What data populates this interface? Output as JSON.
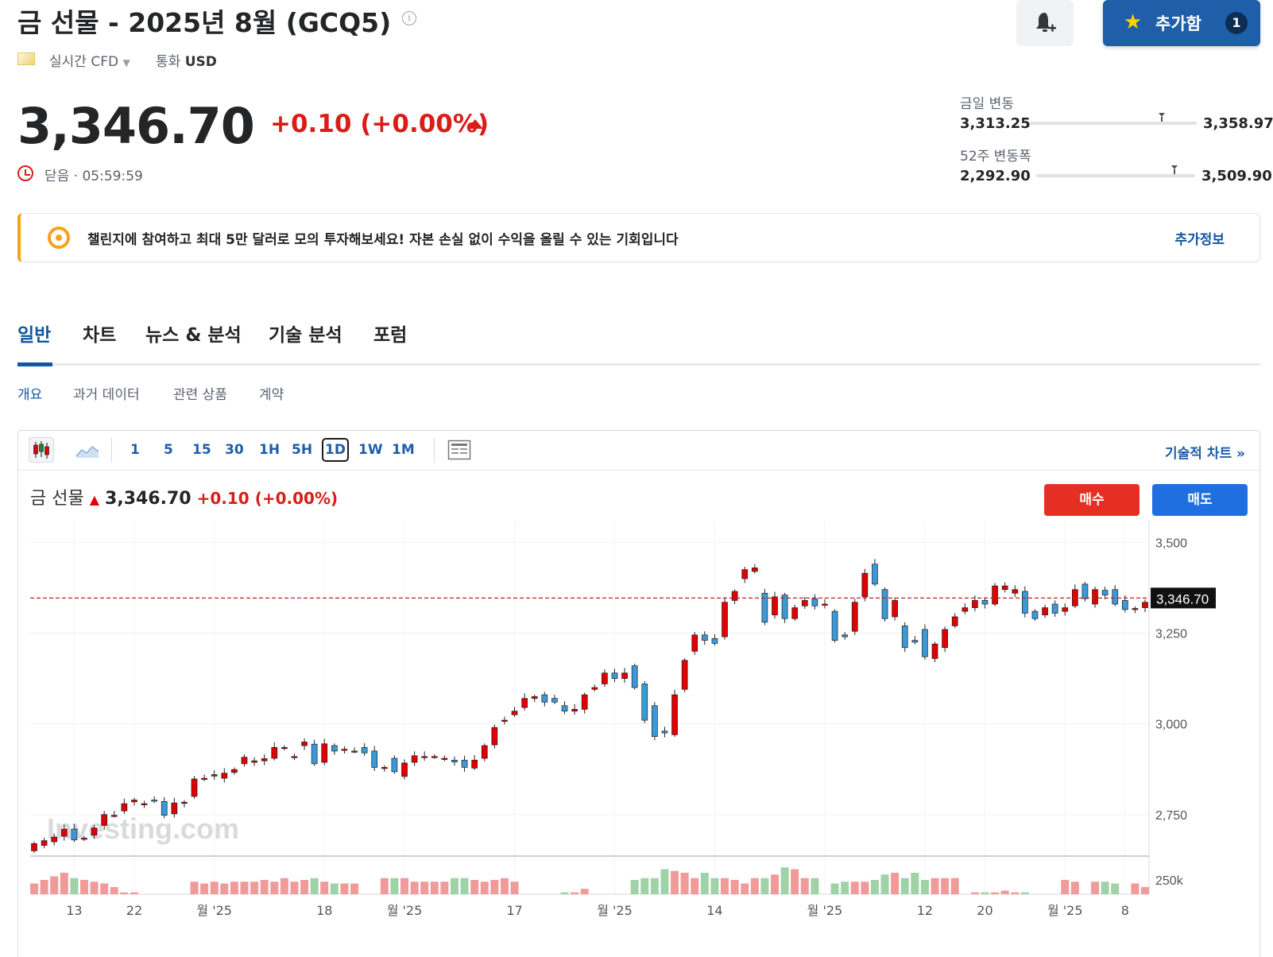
{
  "header": {
    "title": "금 선물 - 2025년 8월 (GCQ5)",
    "info_icon": "info-icon",
    "bell_icon": "bell-plus-icon",
    "watchlist": {
      "label": "추가함",
      "count": "1",
      "icon": "star-icon"
    }
  },
  "meta": {
    "type": "실시간 CFD",
    "currency_label": "통화",
    "currency": "USD"
  },
  "quote": {
    "price": "3,346.70",
    "change": "+0.10 (+0.00%)",
    "status": "닫음 · 05:59:59"
  },
  "ranges": {
    "day": {
      "label": "금일 변동",
      "low": "3,313.25",
      "high": "3,358.97",
      "position": 0.79
    },
    "week52": {
      "label": "52주 변동폭",
      "low": "2,292.90",
      "high": "3,509.90",
      "position": 0.87
    }
  },
  "banner": {
    "text": "챌린지에 참여하고 최대 5만 달러로 모의 투자해보세요! 자본 손실 없이 수익을 올릴 수 있는 기회입니다",
    "link": "추가정보"
  },
  "tabs": [
    "일반",
    "차트",
    "뉴스 & 분석",
    "기술 분석",
    "포럼"
  ],
  "subtabs": [
    "개요",
    "과거 데이터",
    "관련 상품",
    "계약"
  ],
  "toolbar": {
    "timeframes": [
      "1",
      "5",
      "15",
      "30",
      "1H",
      "5H",
      "1D",
      "1W",
      "1M"
    ],
    "active_timeframe": "1D",
    "advanced_link": "기술적 차트 »"
  },
  "chart_header": {
    "name": "금 선물",
    "price": "3,346.70",
    "change": "+0.10",
    "change_pct": "(+0.00%)",
    "buy": "매수",
    "sell": "매도"
  },
  "colors": {
    "up": "#e00000",
    "down": "#3a9ad9",
    "accent": "#1f5ea8",
    "negative": "#d91e18"
  },
  "chart_data": {
    "type": "candlestick",
    "title": "",
    "watermark": "Investing.com",
    "ylim": [
      2640,
      3560
    ],
    "y_ticks": [
      3500,
      3250,
      3000,
      2750
    ],
    "y_tick_labels": [
      "3,500",
      "3,250",
      "3,000",
      "2,750"
    ],
    "last_price": 3346.7,
    "last_price_label": "3,346.70",
    "x_tick_labels": [
      "13",
      "22",
      "월 '25",
      "18",
      "월 '25",
      "17",
      "월 '25",
      "14",
      "월 '25",
      "12",
      "20",
      "월 '25",
      "8"
    ],
    "x_tick_index": [
      4,
      10,
      18,
      29,
      37,
      48,
      58,
      68,
      79,
      89,
      95,
      103,
      109
    ],
    "volume_label": "250k",
    "candles": [
      [
        2650,
        2670
      ],
      [
        2665,
        2678
      ],
      [
        2675,
        2688
      ],
      [
        2690,
        2710
      ],
      [
        2710,
        2680
      ],
      [
        2685,
        2685
      ],
      [
        2693,
        2713
      ],
      [
        2720,
        2750
      ],
      [
        2748,
        2748
      ],
      [
        2760,
        2780
      ],
      [
        2785,
        2790
      ],
      [
        2780,
        2780
      ],
      [
        2790,
        2788
      ],
      [
        2786,
        2748
      ],
      [
        2752,
        2782
      ],
      [
        2782,
        2784
      ],
      [
        2800,
        2848
      ],
      [
        2850,
        2850
      ],
      [
        2856,
        2860
      ],
      [
        2850,
        2864
      ],
      [
        2866,
        2874
      ],
      [
        2890,
        2908
      ],
      [
        2894,
        2898
      ],
      [
        2898,
        2904
      ],
      [
        2905,
        2935
      ],
      [
        2935,
        2935
      ],
      [
        2910,
        2910
      ],
      [
        2940,
        2950
      ],
      [
        2944,
        2890
      ],
      [
        2894,
        2945
      ],
      [
        2940,
        2925
      ],
      [
        2930,
        2930
      ],
      [
        2925,
        2925
      ],
      [
        2935,
        2920
      ],
      [
        2925,
        2880
      ],
      [
        2880,
        2880
      ],
      [
        2905,
        2868
      ],
      [
        2855,
        2892
      ],
      [
        2894,
        2912
      ],
      [
        2910,
        2910
      ],
      [
        2910,
        2910
      ],
      [
        2905,
        2905
      ],
      [
        2900,
        2895
      ],
      [
        2900,
        2880
      ],
      [
        2878,
        2900
      ],
      [
        2905,
        2940
      ],
      [
        2942,
        2990
      ],
      [
        3010,
        3010
      ],
      [
        3025,
        3035
      ],
      [
        3045,
        3070
      ],
      [
        3070,
        3075
      ],
      [
        3080,
        3060
      ],
      [
        3070,
        3060
      ],
      [
        3050,
        3035
      ],
      [
        3035,
        3040
      ],
      [
        3040,
        3080
      ],
      [
        3095,
        3100
      ],
      [
        3110,
        3140
      ],
      [
        3140,
        3125
      ],
      [
        3125,
        3140
      ],
      [
        3160,
        3100
      ],
      [
        3110,
        3010
      ],
      [
        3050,
        2965
      ],
      [
        2980,
        2975
      ],
      [
        2970,
        3080
      ],
      [
        3095,
        3175
      ],
      [
        3200,
        3245
      ],
      [
        3245,
        3230
      ],
      [
        3235,
        3222
      ],
      [
        3240,
        3335
      ],
      [
        3340,
        3365
      ],
      [
        3400,
        3425
      ],
      [
        3420,
        3430
      ],
      [
        3360,
        3280
      ],
      [
        3300,
        3350
      ],
      [
        3355,
        3290
      ],
      [
        3290,
        3320
      ],
      [
        3325,
        3340
      ],
      [
        3345,
        3325
      ],
      [
        3330,
        3330
      ],
      [
        3310,
        3230
      ],
      [
        3245,
        3240
      ],
      [
        3255,
        3335
      ],
      [
        3350,
        3415
      ],
      [
        3440,
        3385
      ],
      [
        3370,
        3290
      ],
      [
        3295,
        3340
      ],
      [
        3270,
        3210
      ],
      [
        3230,
        3225
      ],
      [
        3260,
        3185
      ],
      [
        3180,
        3220
      ],
      [
        3210,
        3260
      ],
      [
        3270,
        3295
      ],
      [
        3310,
        3320
      ],
      [
        3320,
        3340
      ],
      [
        3340,
        3330
      ],
      [
        3330,
        3380
      ],
      [
        3370,
        3380
      ],
      [
        3360,
        3370
      ],
      [
        3365,
        3305
      ],
      [
        3310,
        3290
      ],
      [
        3300,
        3320
      ],
      [
        3330,
        3305
      ],
      [
        3310,
        3320
      ],
      [
        3325,
        3370
      ],
      [
        3385,
        3345
      ],
      [
        3330,
        3370
      ],
      [
        3368,
        3355
      ],
      [
        3370,
        3330
      ],
      [
        3340,
        3315
      ],
      [
        3315,
        3318
      ],
      [
        3320,
        3335
      ]
    ],
    "volumes": [
      0.3,
      0.4,
      0.5,
      0.6,
      0.45,
      0.4,
      0.35,
      0.3,
      0.2,
      0.05,
      0.05,
      0.0,
      0.0,
      0.0,
      0.0,
      0.0,
      0.35,
      0.3,
      0.35,
      0.3,
      0.35,
      0.35,
      0.35,
      0.4,
      0.35,
      0.45,
      0.35,
      0.4,
      0.45,
      0.35,
      0.3,
      0.3,
      0.3,
      0.0,
      0.0,
      0.45,
      0.45,
      0.45,
      0.35,
      0.35,
      0.35,
      0.35,
      0.45,
      0.45,
      0.4,
      0.35,
      0.4,
      0.45,
      0.35,
      0.0,
      0.0,
      0.0,
      0.0,
      0.05,
      0.05,
      0.15,
      0.0,
      0.0,
      0.0,
      0.0,
      0.4,
      0.45,
      0.45,
      0.7,
      0.65,
      0.6,
      0.45,
      0.6,
      0.45,
      0.45,
      0.4,
      0.3,
      0.45,
      0.45,
      0.55,
      0.75,
      0.7,
      0.45,
      0.45,
      0.0,
      0.3,
      0.35,
      0.35,
      0.35,
      0.4,
      0.55,
      0.6,
      0.45,
      0.6,
      0.4,
      0.45,
      0.45,
      0.45,
      0.0,
      0.05,
      0.05,
      0.05,
      0.1,
      0.05,
      0.05,
      0.0,
      0.0,
      0.0,
      0.4,
      0.35,
      0.0,
      0.35,
      0.35,
      0.3,
      0.0,
      0.3,
      0.2
    ]
  }
}
